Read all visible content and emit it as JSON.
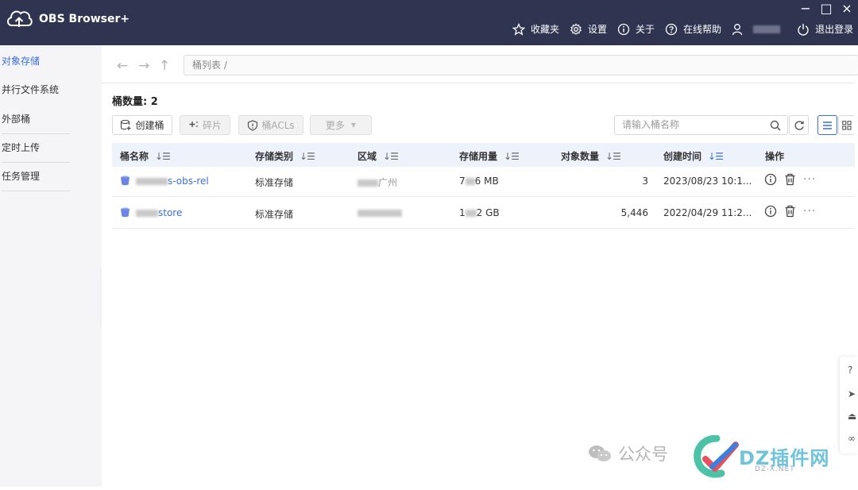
{
  "window": {
    "title": "OBS Browser+",
    "controls": {
      "minimize": "−",
      "maximize": "□",
      "close": "×"
    }
  },
  "top_menu": {
    "favorites": "收藏夹",
    "settings": "设置",
    "about": "关于",
    "help": "在线帮助",
    "logout": "退出登录"
  },
  "sidebar": {
    "items": [
      {
        "label": "对象存储"
      },
      {
        "label": "并行文件系统"
      },
      {
        "label": "外部桶"
      },
      {
        "label": "定时上传"
      },
      {
        "label": "任务管理"
      }
    ]
  },
  "nav": {
    "back": "←",
    "forward": "→",
    "up": "↑",
    "path": "桶列表 /"
  },
  "summary": {
    "bucket_count": "桶数量: 2"
  },
  "toolbar": {
    "create_bucket": "创建桶",
    "fragments": "碎片",
    "bucket_acls": "桶ACLs",
    "more": "更多"
  },
  "search": {
    "placeholder": "请输入桶名称"
  },
  "table": {
    "columns": [
      "桶名称",
      "存储类别",
      "区域",
      "存储用量",
      "对象数量",
      "创建时间",
      "操作"
    ],
    "rows": [
      {
        "name_suffix": "s-obs-rel",
        "storage_class": "标准存储",
        "region_suffix": "广州",
        "usage_prefix": "7",
        "usage_suffix": "6 MB",
        "objects": "3",
        "created": "2023/08/23 10:1..."
      },
      {
        "name_suffix": "store",
        "storage_class": "标准存储",
        "region_suffix": "",
        "usage_prefix": "1",
        "usage_suffix": "2 GB",
        "objects": "5,446",
        "created": "2022/04/29 11:2..."
      }
    ]
  },
  "watermark": {
    "wechat_text": "公众号",
    "brand": "DZ插件网",
    "domain": "DZ-X.NET"
  },
  "colors": {
    "titlebar": "#2f3450",
    "accent": "#3a6fd8",
    "sidebar_bg": "#f5f5f7",
    "table_header_bg": "#eef3fb"
  },
  "icons": [
    "cloud-upload-logo-icon",
    "star-icon",
    "gear-icon",
    "info-icon",
    "help-icon",
    "user-icon",
    "power-icon",
    "bucket-icon",
    "trash-icon",
    "refresh-icon",
    "list-view-icon",
    "grid-view-icon",
    "search-icon"
  ]
}
